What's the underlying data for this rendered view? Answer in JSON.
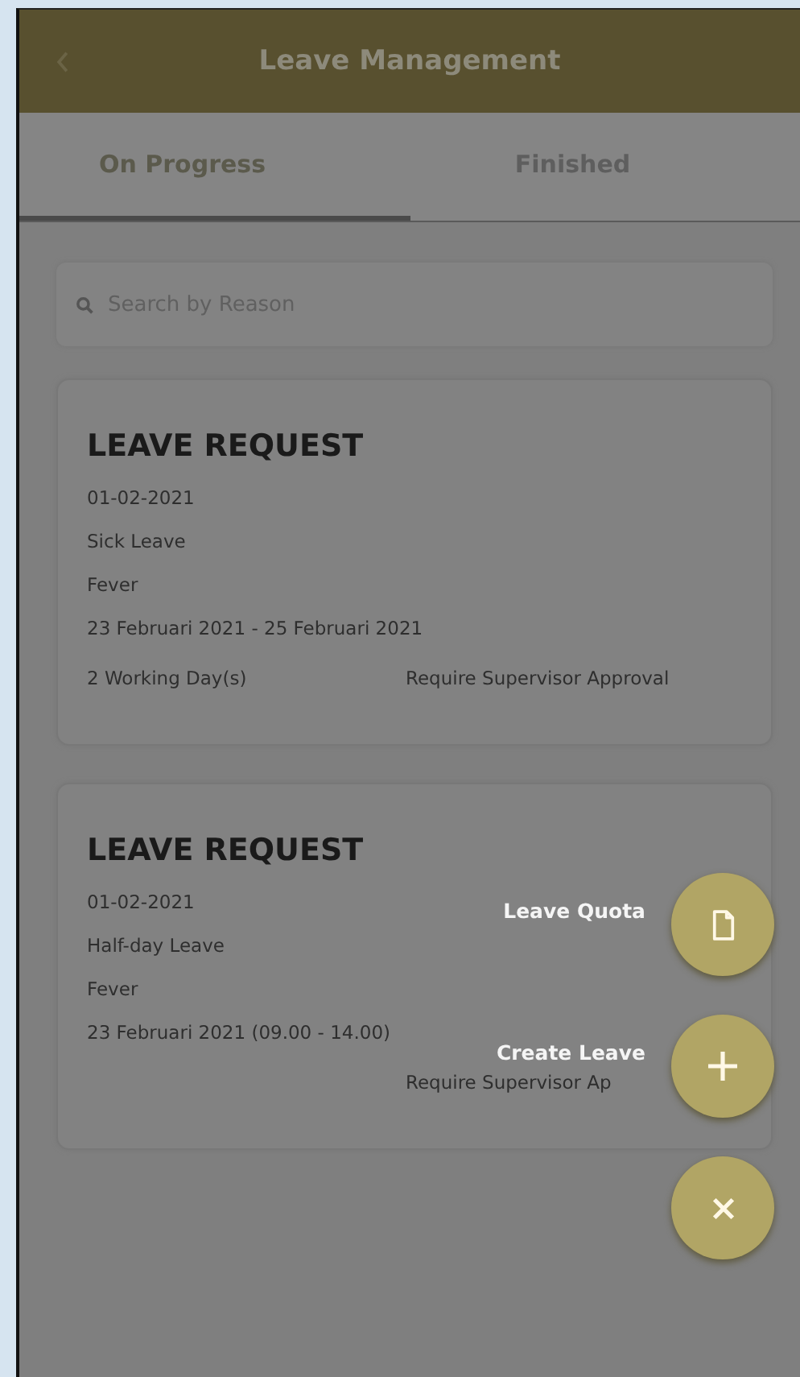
{
  "header": {
    "title": "Leave Management"
  },
  "tabs": [
    {
      "label": "On Progress",
      "selected": true
    },
    {
      "label": "Finished",
      "selected": false
    }
  ],
  "search": {
    "placeholder": "Search by Reason"
  },
  "requests": [
    {
      "title": "LEAVE REQUEST",
      "date": "01-02-2021",
      "type": "Sick Leave",
      "reason": "Fever",
      "period": "23 Februari 2021 - 25 Februari 2021",
      "duration": "2 Working Day(s)",
      "status": "Require Supervisor Approval"
    },
    {
      "title": "LEAVE REQUEST",
      "date": "01-02-2021",
      "type": "Half-day Leave",
      "reason": "Fever",
      "period": "23 Februari 2021 (09.00 - 14.00)",
      "status": "Require Supervisor Ap"
    }
  ],
  "fab_menu": {
    "actions": [
      {
        "label": "Leave Quota",
        "kind": "quota"
      },
      {
        "label": "Create Leave",
        "kind": "create"
      }
    ]
  }
}
